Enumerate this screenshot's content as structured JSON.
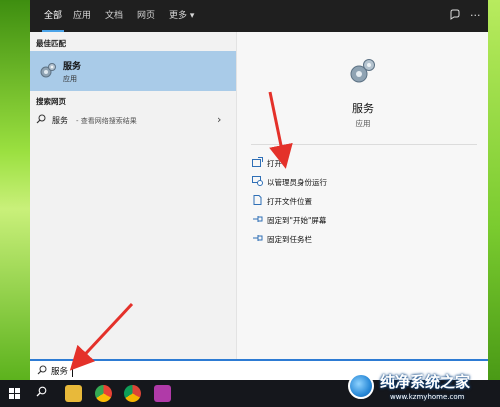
{
  "tabs": [
    {
      "label": "全部",
      "active": true
    },
    {
      "label": "应用",
      "active": false
    },
    {
      "label": "文档",
      "active": false
    },
    {
      "label": "网页",
      "active": false
    },
    {
      "label": "更多 ▾",
      "active": false
    }
  ],
  "top_icons": [
    "feedback-icon",
    "more-options-icon"
  ],
  "left_pane": {
    "best_match_header": "最佳匹配",
    "best_match": {
      "title": "服务",
      "subtitle": "应用",
      "icon": "gear-icon"
    },
    "web_header": "搜索网页",
    "web_result": {
      "term": "服务",
      "hint": " - 查看网络搜索结果"
    }
  },
  "right_pane": {
    "title": "服务",
    "subtitle": "应用",
    "actions": [
      {
        "label": "打开",
        "icon": "open-icon"
      },
      {
        "label": "以管理员身份运行",
        "icon": "run-as-admin-icon"
      },
      {
        "label": "打开文件位置",
        "icon": "file-location-icon"
      },
      {
        "label": "固定到\"开始\"屏幕",
        "icon": "pin-start-icon"
      },
      {
        "label": "固定到任务栏",
        "icon": "pin-taskbar-icon"
      }
    ]
  },
  "search": {
    "value": "服务",
    "icon": "search-icon"
  },
  "taskbar": {
    "apps": [
      "file-explorer-icon",
      "browser-360-icon",
      "chrome-icon",
      "onenote-icon"
    ]
  },
  "watermark": {
    "name": "纯净系统之家",
    "url": "www.kzmyhome.com"
  },
  "colors": {
    "accent": "#2d7bd3",
    "selected": "#a9cbe8",
    "arrow": "#e4312a"
  }
}
